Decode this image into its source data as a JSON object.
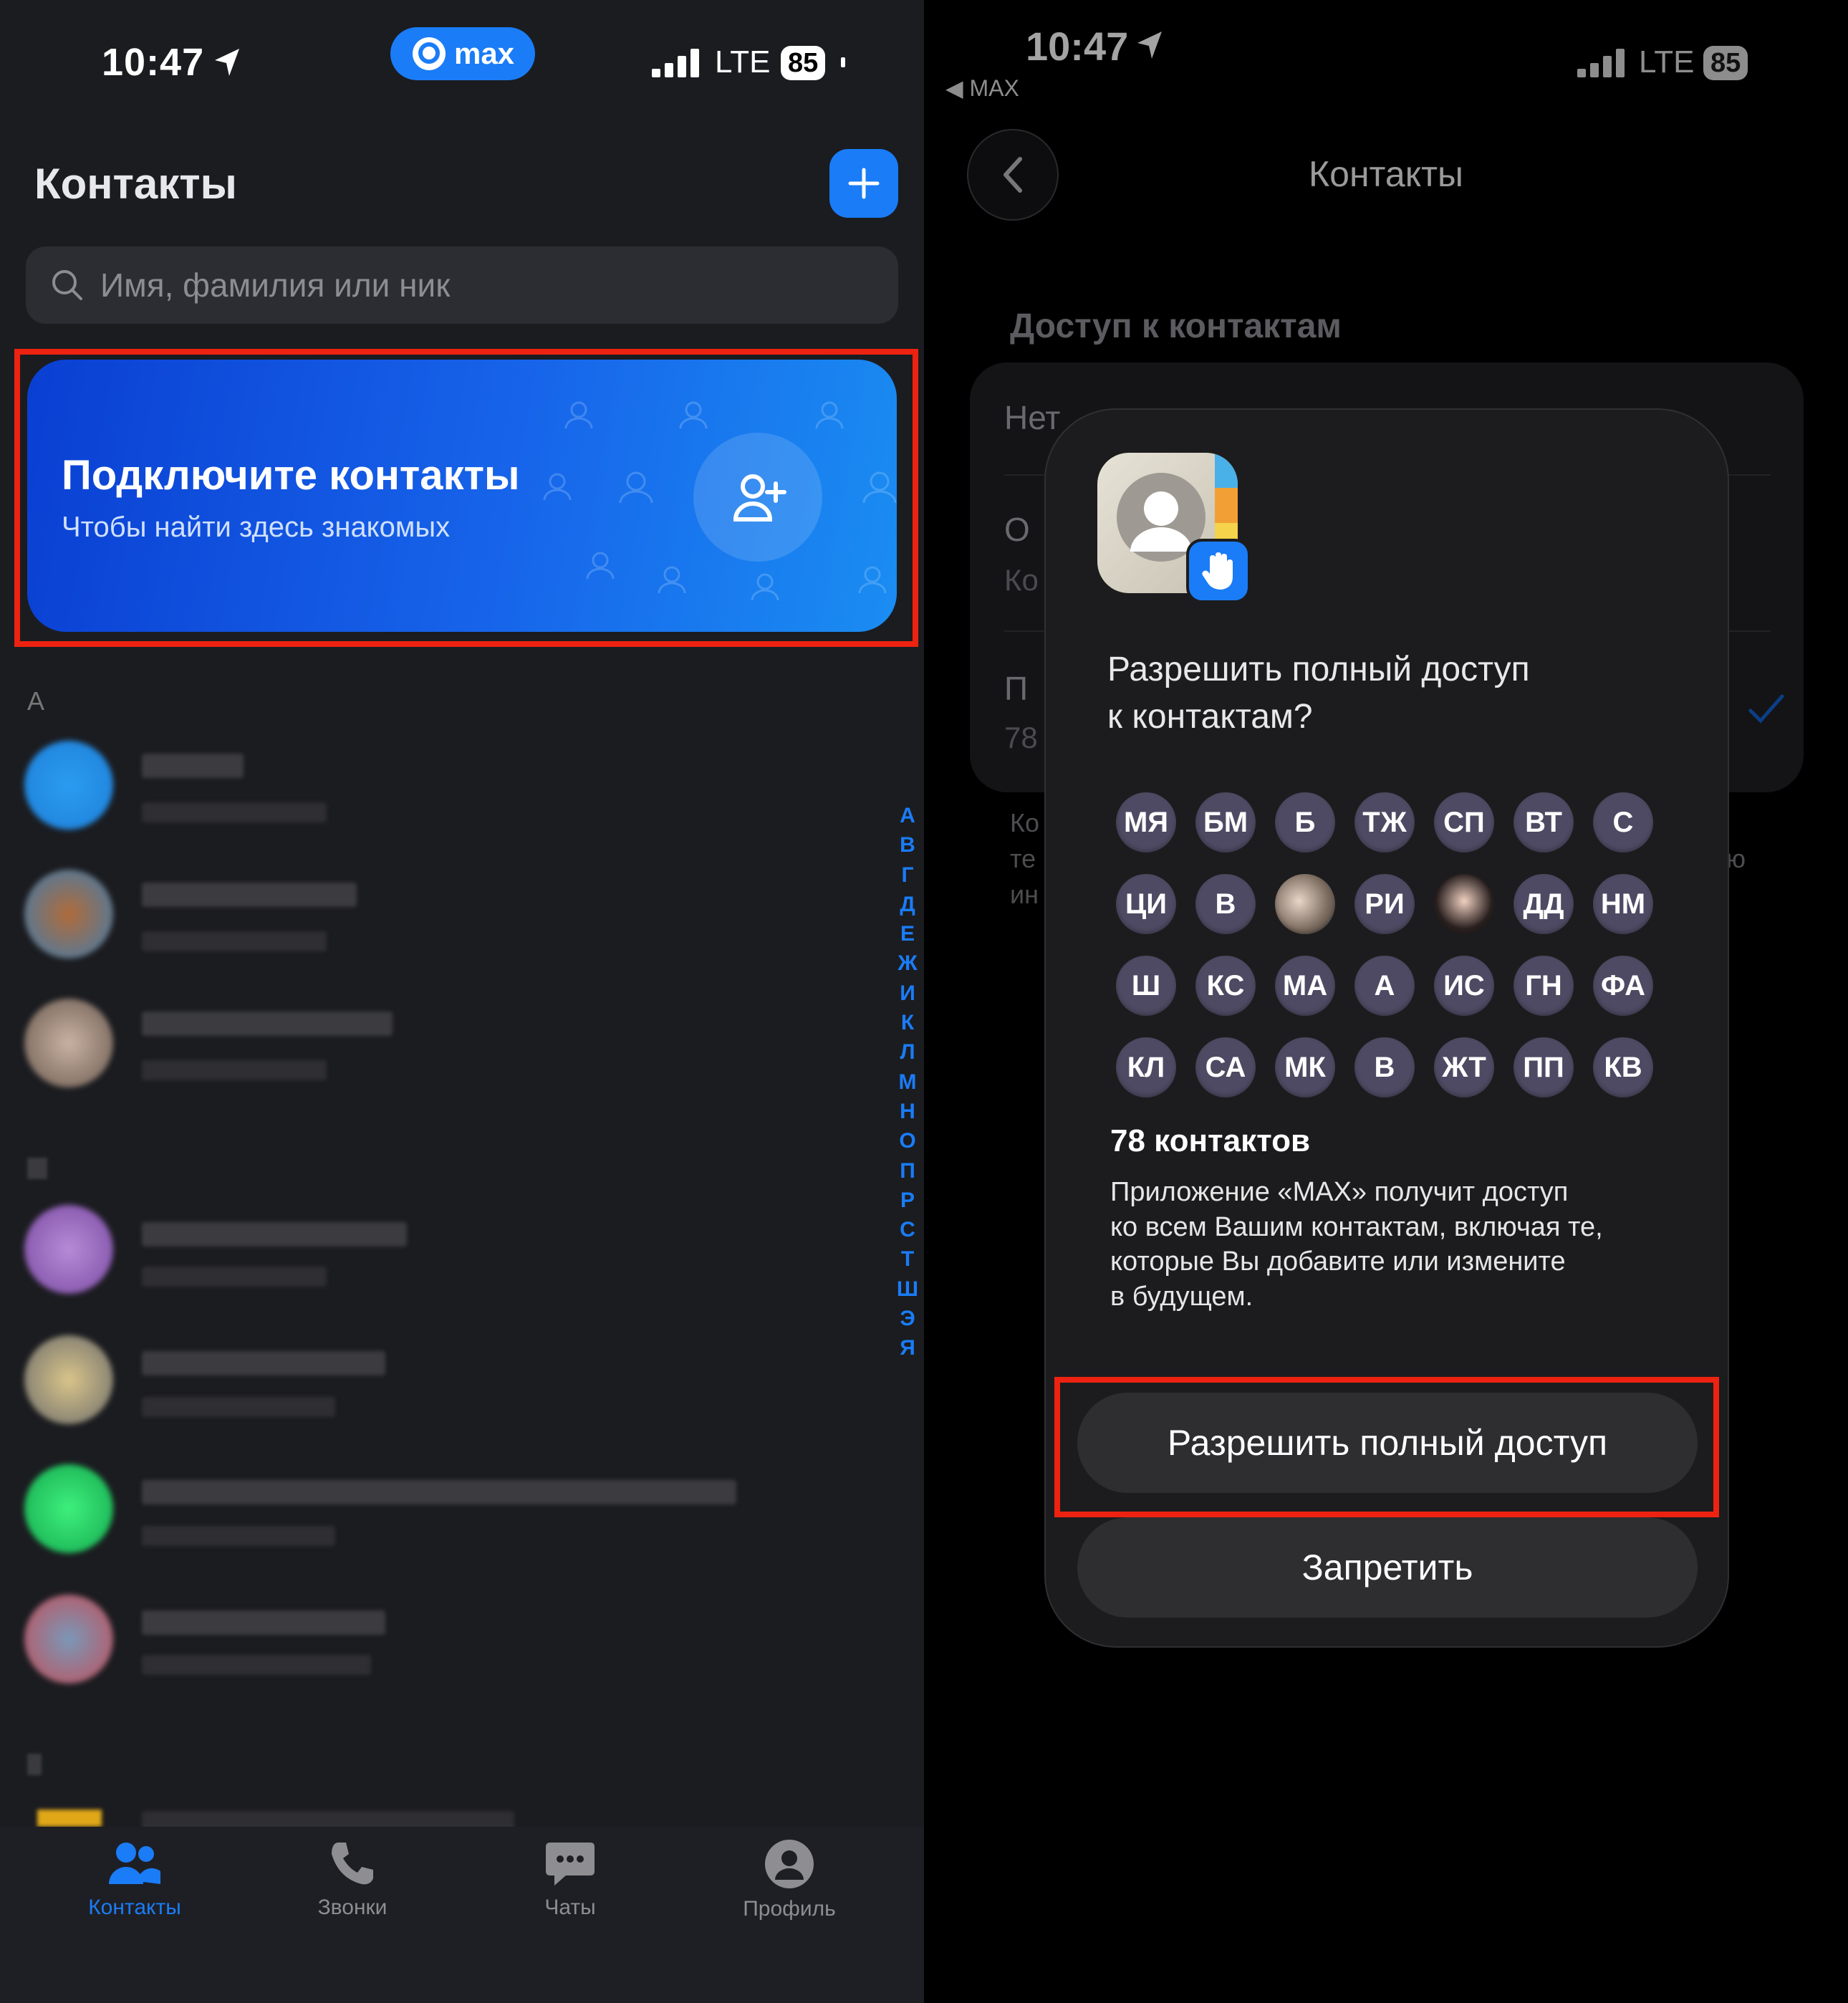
{
  "left": {
    "status": {
      "time": "10:47",
      "carrier": "LTE",
      "battery": "85",
      "app_pill": "max"
    },
    "title": "Контакты",
    "search": {
      "placeholder": "Имя, фамилия или ник"
    },
    "banner": {
      "title": "Подключите контакты",
      "subtitle": "Чтобы найти здесь знакомых"
    },
    "section_a": "А",
    "alphabet": [
      "А",
      "В",
      "Г",
      "Д",
      "Е",
      "Ж",
      "И",
      "К",
      "Л",
      "М",
      "Н",
      "О",
      "П",
      "Р",
      "С",
      "Т",
      "Ш",
      "Э",
      "Я"
    ],
    "tabs": [
      {
        "label": "Контакты",
        "icon": "contacts-icon",
        "active": true
      },
      {
        "label": "Звонки",
        "icon": "phone-icon",
        "active": false
      },
      {
        "label": "Чаты",
        "icon": "chat-icon",
        "active": false
      },
      {
        "label": "Профиль",
        "icon": "profile-icon",
        "active": false
      }
    ],
    "colors": {
      "accent": "#1a7cf7",
      "highlight": "#ee2211"
    }
  },
  "right": {
    "status": {
      "time": "10:47",
      "back_app": "◀ MAX",
      "carrier": "LTE",
      "battery": "85"
    },
    "title": "Контакты",
    "section": "Доступ к контактам",
    "card_items": [
      "Нет",
      "О",
      "Ко",
      "П",
      "78"
    ],
    "note_lines": [
      "Ко",
      "те",
      "ин",
      "ю"
    ],
    "modal": {
      "question_line1": "Разрешить полный доступ",
      "question_line2": "к контактам?",
      "initials": [
        "МЯ",
        "БМ",
        "Б",
        "ТЖ",
        "СП",
        "ВТ",
        "С",
        "ЦИ",
        "В",
        "",
        "РИ",
        "",
        "ДД",
        "НМ",
        "Ш",
        "КС",
        "МА",
        "А",
        "ИС",
        "ГН",
        "ФА",
        "КЛ",
        "СА",
        "МК",
        "В",
        "ЖТ",
        "ПП",
        "КВ"
      ],
      "count": "78 контактов",
      "body_line1": "Приложение «MAX» получит доступ",
      "body_line2": "ко всем Вашим контактам, включая те,",
      "body_line3": "которые Вы добавите или измените",
      "body_line4": "в будущем.",
      "allow": "Разрешить полный доступ",
      "deny": "Запретить"
    }
  }
}
